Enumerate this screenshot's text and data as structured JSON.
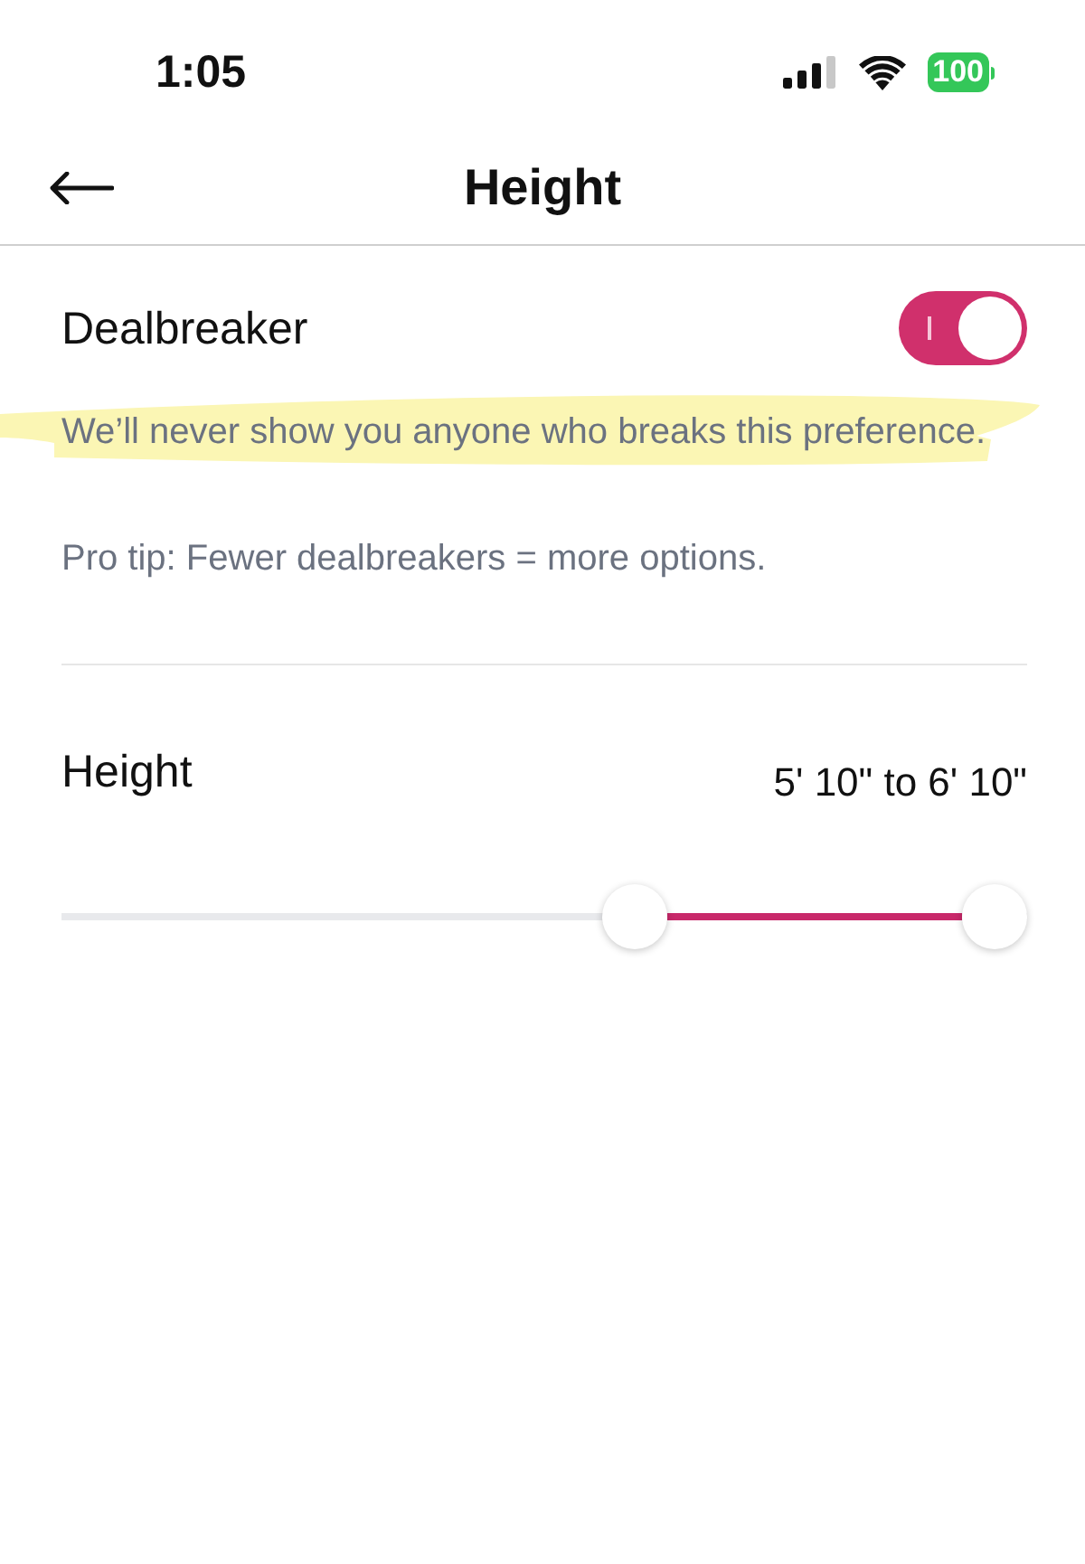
{
  "status_bar": {
    "time": "1:05",
    "battery": "100"
  },
  "header": {
    "title": "Height"
  },
  "dealbreaker": {
    "label": "Dealbreaker",
    "on": true,
    "description": "We’ll never show you anyone who breaks this preference.",
    "tip": "Pro tip: Fewer dealbreakers = more options."
  },
  "height_filter": {
    "label": "Height",
    "reading": "5' 10\" to 6' 10\"",
    "thumbs": [
      {
        "level": 0.6
      },
      {
        "level": 1
      }
    ]
  }
}
